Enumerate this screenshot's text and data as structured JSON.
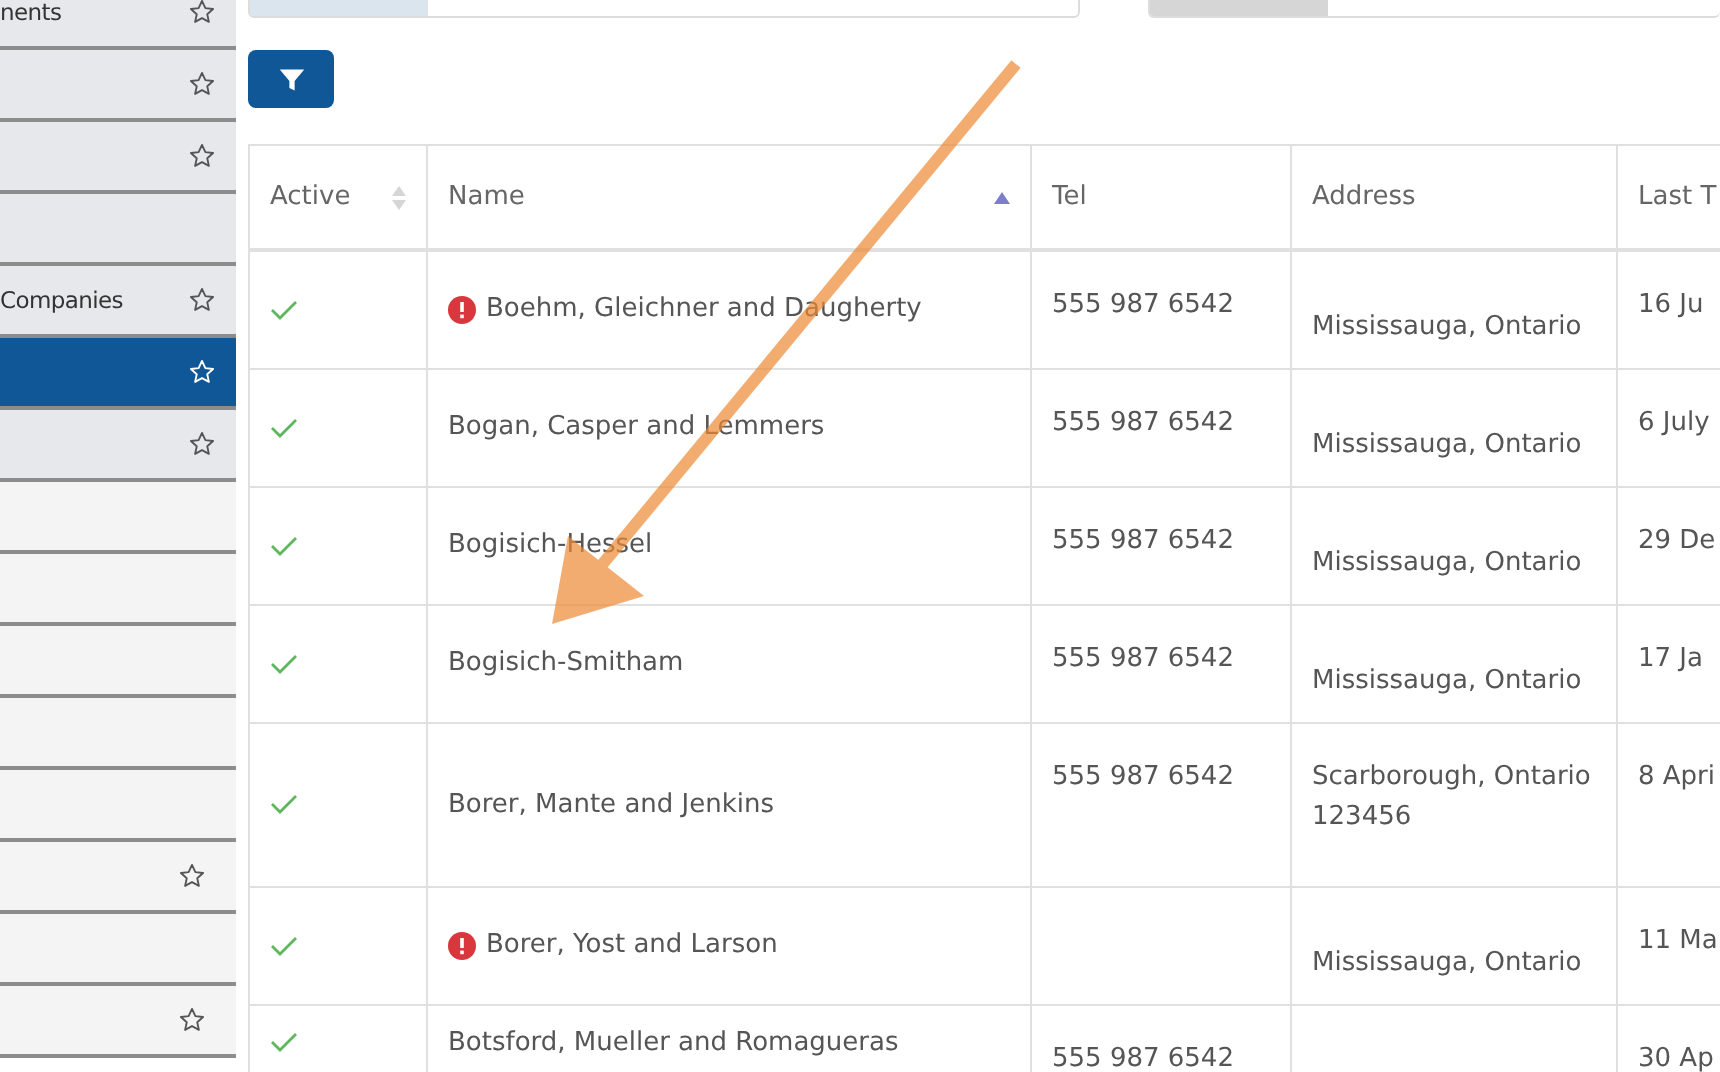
{
  "sidebar": {
    "items": [
      {
        "label": "nents",
        "kind": "main",
        "star": true,
        "selected": false
      },
      {
        "kind": "main",
        "star": true,
        "selected": false
      },
      {
        "kind": "main",
        "star": true,
        "selected": false
      },
      {
        "kind": "main",
        "star": false,
        "selected": false
      },
      {
        "label": "Companies",
        "kind": "main",
        "star": true,
        "selected": false
      },
      {
        "kind": "main",
        "star": true,
        "selected": true
      },
      {
        "kind": "main",
        "star": true,
        "selected": false
      },
      {
        "kind": "sub",
        "star": false,
        "selected": false
      },
      {
        "kind": "sub",
        "star": false,
        "selected": false
      },
      {
        "kind": "sub",
        "star": false,
        "selected": false
      },
      {
        "kind": "sub",
        "star": false,
        "selected": false
      },
      {
        "kind": "sub",
        "star": false,
        "selected": false
      },
      {
        "kind": "sub",
        "star": true,
        "selected": false
      },
      {
        "kind": "sub",
        "star": false,
        "selected": false
      },
      {
        "kind": "sub",
        "star": true,
        "selected": false
      }
    ]
  },
  "table": {
    "columns": [
      {
        "label": "Active",
        "sortable": true,
        "sorted": false
      },
      {
        "label": "Name",
        "sortable": true,
        "sorted": true
      },
      {
        "label": "Tel",
        "sortable": false
      },
      {
        "label": "Address",
        "sortable": false
      },
      {
        "label": "Last T",
        "sortable": false
      }
    ],
    "rows": [
      {
        "active": true,
        "alert": true,
        "name": "Boehm, Gleichner and Daugherty",
        "tel": "555 987 6542",
        "address": [
          "Mississauga, Ontario"
        ],
        "date": "16 Ju"
      },
      {
        "active": true,
        "alert": false,
        "name": "Bogan, Casper and Lemmers",
        "tel": "555 987 6542",
        "address": [
          "Mississauga, Ontario"
        ],
        "date": "6 July"
      },
      {
        "active": true,
        "alert": false,
        "name": "Bogisich-Hessel",
        "tel": "555 987 6542",
        "address": [
          "Mississauga, Ontario"
        ],
        "date": "29 De"
      },
      {
        "active": true,
        "alert": false,
        "name": "Bogisich-Smitham",
        "tel": "555 987 6542",
        "address": [
          "Mississauga, Ontario"
        ],
        "date": "17 Ja"
      },
      {
        "active": true,
        "alert": false,
        "name": "Borer, Mante and Jenkins",
        "tel": "555 987 6542",
        "address": [
          "Scarborough, Ontario",
          "123456"
        ],
        "date": "8 Apri"
      },
      {
        "active": true,
        "alert": true,
        "name": "Borer, Yost and Larson",
        "address": [
          "Mississauga, Ontario"
        ],
        "date": "11 Ma"
      },
      {
        "active": true,
        "alert": false,
        "name": "Botsford, Mueller and Romagueras",
        "tel": "555 987 6542",
        "address": [],
        "date": "30 Ap"
      }
    ]
  }
}
